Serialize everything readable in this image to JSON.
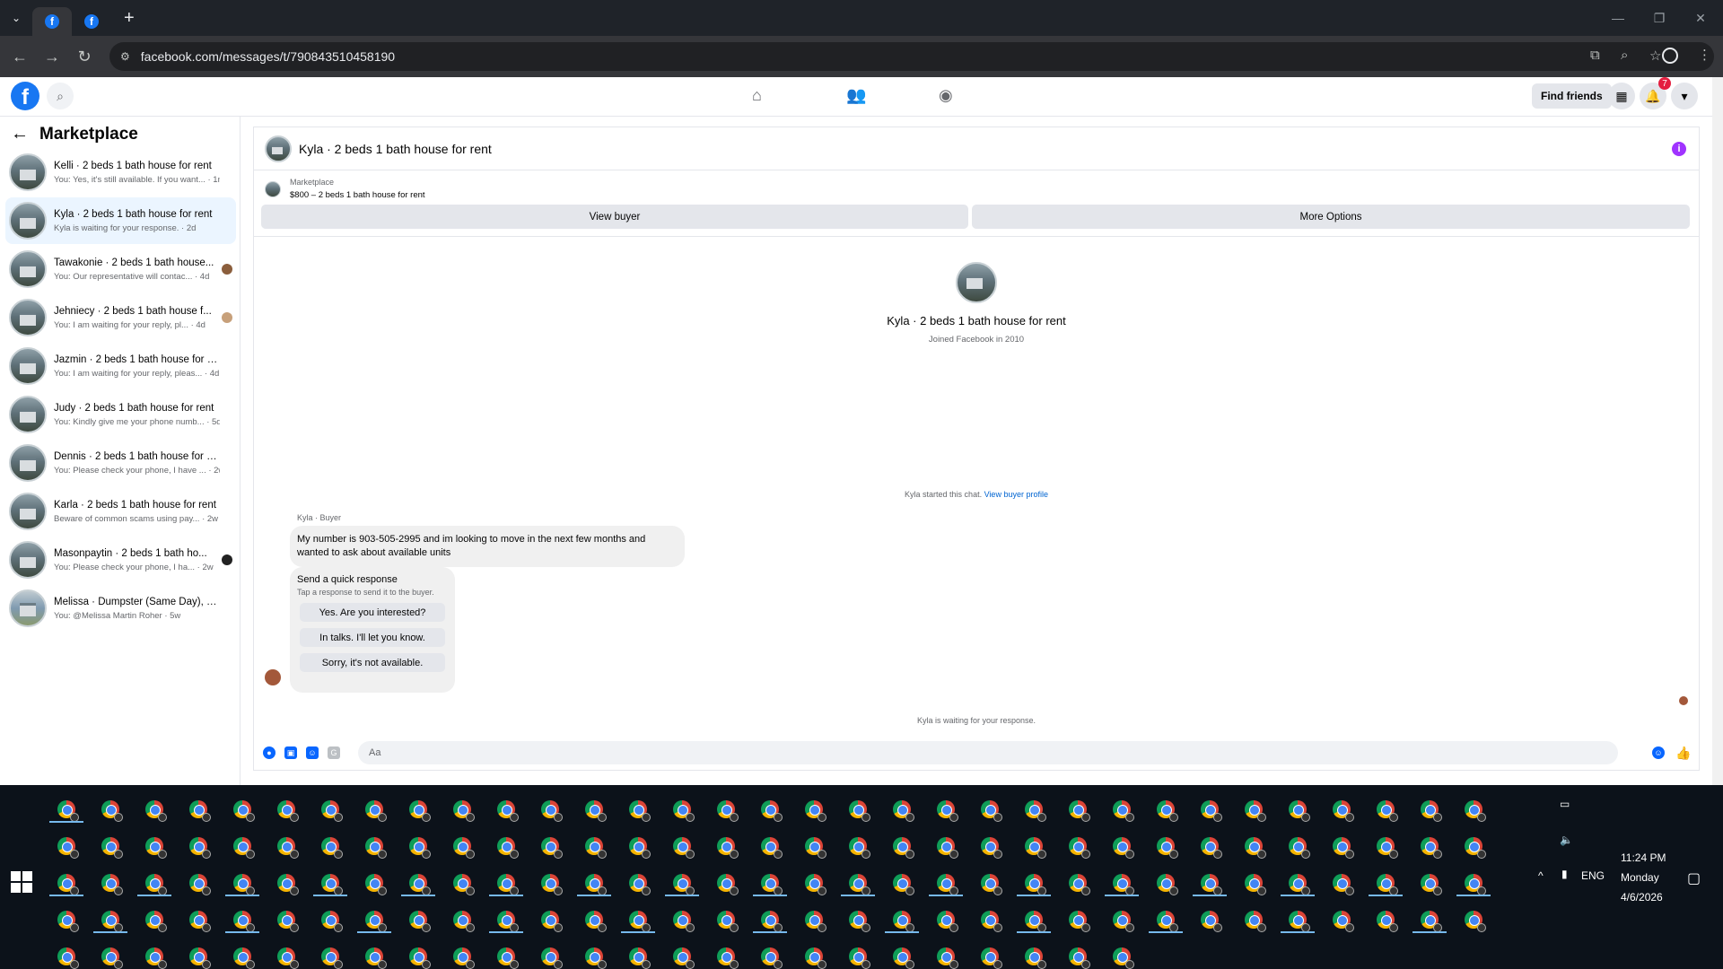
{
  "browser": {
    "url": "facebook.com/messages/t/790843510458190"
  },
  "fb": {
    "find_friends": "Find friends",
    "notif_count": "7"
  },
  "sidebar": {
    "title": "Marketplace",
    "conversations": [
      {
        "name": "Kelli · 2 beds 1 bath house for rent",
        "preview": "You: Yes, it's still available. If you want... · 1m"
      },
      {
        "name": "Kyla · 2 beds 1 bath house for rent",
        "preview": "Kyla is waiting for your response. · 2d"
      },
      {
        "name": "Tawakonie · 2 beds 1 bath house...",
        "preview": "You: Our representative will contac... · 4d"
      },
      {
        "name": "Jehniecy · 2 beds 1 bath house f...",
        "preview": "You: I am waiting for your reply, pl... · 4d"
      },
      {
        "name": "Jazmin · 2 beds 1 bath house for re...",
        "preview": "You: I am waiting for your reply, pleas... · 4d"
      },
      {
        "name": "Judy · 2 beds 1 bath house for rent",
        "preview": "You: Kindly give me your phone numb... · 5d"
      },
      {
        "name": "Dennis · 2 beds 1 bath house for re...",
        "preview": "You: Please check your phone, I have ... · 2w"
      },
      {
        "name": "Karla · 2 beds 1 bath house for rent",
        "preview": "Beware of common scams using pay... · 2w"
      },
      {
        "name": "Masonpaytin · 2 beds 1 bath ho...",
        "preview": "You: Please check your phone, I ha... · 2w"
      },
      {
        "name": "Melissa · Dumpster (Same Day), Re...",
        "preview": "You: @Melissa Martin Roher · 5w"
      }
    ]
  },
  "chat": {
    "title": "Kyla · 2 beds 1 bath house for rent",
    "listing_label": "Marketplace",
    "listing_title": "$800 – 2 beds 1 bath house for rent",
    "view_buyer": "View buyer",
    "more_options": "More Options",
    "profile_name": "Kyla · 2 beds 1 bath house for rent",
    "profile_joined": "Joined Facebook in 2010",
    "started": "Kyla started this chat.",
    "view_profile": "View buyer profile",
    "sender": "Kyla · Buyer",
    "message": "My number is 903-505-2995 and im looking to move in the next few months and wanted to ask about available units",
    "quick_title": "Send a quick response",
    "quick_sub": "Tap a response to send it to the buyer.",
    "quick": [
      "Yes. Are you interested?",
      "In talks. I'll let you know.",
      "Sorry, it's not available."
    ],
    "waiting": "Kyla is waiting for your response.",
    "placeholder": "Aa"
  },
  "taskbar": {
    "time": "11:24 PM",
    "day": "Monday",
    "date": "4/6/2026",
    "lang": "ENG"
  }
}
